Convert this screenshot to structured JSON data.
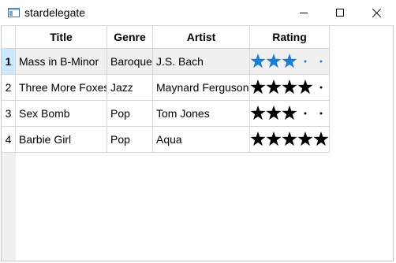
{
  "window": {
    "title": "stardelegate"
  },
  "table": {
    "columns": [
      "Title",
      "Genre",
      "Artist",
      "Rating"
    ],
    "rows": [
      {
        "num": "1",
        "title": "Mass in B-Minor",
        "genre": "Baroque",
        "artist": "J.S. Bach",
        "rating": 3,
        "max_rating": 5
      },
      {
        "num": "2",
        "title": "Three More Foxes",
        "genre": "Jazz",
        "artist": "Maynard Ferguson",
        "rating": 4,
        "max_rating": 5
      },
      {
        "num": "3",
        "title": "Sex Bomb",
        "genre": "Pop",
        "artist": "Tom Jones",
        "rating": 3,
        "max_rating": 5
      },
      {
        "num": "4",
        "title": "Barbie Girl",
        "genre": "Pop",
        "artist": "Aqua",
        "rating": 5,
        "max_rating": 5
      }
    ],
    "selected_row": 1
  },
  "colors": {
    "editor_star": "#1a7fd4",
    "star": "#000000"
  }
}
